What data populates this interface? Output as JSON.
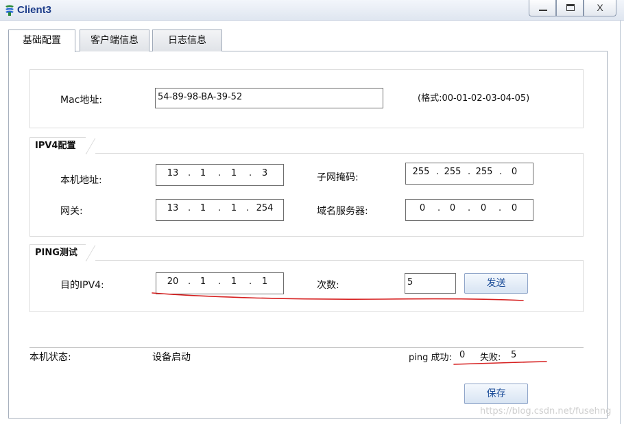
{
  "window": {
    "title": "Client3",
    "minimize": "_",
    "maximize": "□",
    "close": "X"
  },
  "tabs": [
    {
      "label": "基础配置",
      "active": true
    },
    {
      "label": "客户端信息",
      "active": false
    },
    {
      "label": "日志信息",
      "active": false
    }
  ],
  "mac": {
    "label": "Mac地址:",
    "value": "54-89-98-BA-39-52",
    "format_hint": "(格式:00-01-02-03-04-05)"
  },
  "ipv4": {
    "section_title": "IPV4配置",
    "local_ip": {
      "label": "本机地址:",
      "octets": [
        "13",
        "1",
        "1",
        "3"
      ]
    },
    "subnet_mask": {
      "label": "子网掩码:",
      "octets": [
        "255",
        "255",
        "255",
        "0"
      ]
    },
    "gateway": {
      "label": "网关:",
      "octets": [
        "13",
        "1",
        "1",
        "254"
      ]
    },
    "dns": {
      "label": "域名服务器:",
      "octets": [
        "0",
        "0",
        "0",
        "0"
      ]
    }
  },
  "ping": {
    "section_title": "PING测试",
    "dest": {
      "label": "目的IPV4:",
      "octets": [
        "20",
        "1",
        "1",
        "1"
      ]
    },
    "count": {
      "label": "次数:",
      "value": "5"
    },
    "send_label": "发送"
  },
  "status": {
    "label": "本机状态:",
    "value": "设备启动",
    "ping_success_label": "ping 成功:",
    "ping_success_value": "0",
    "fail_label": "失败:",
    "fail_value": "5"
  },
  "save_label": "保存",
  "watermark": "https://blog.csdn.net/fusehng",
  "colors": {
    "annotation": "#d62020",
    "title": "#1d3d8a",
    "button_text": "#1f4f9a"
  }
}
